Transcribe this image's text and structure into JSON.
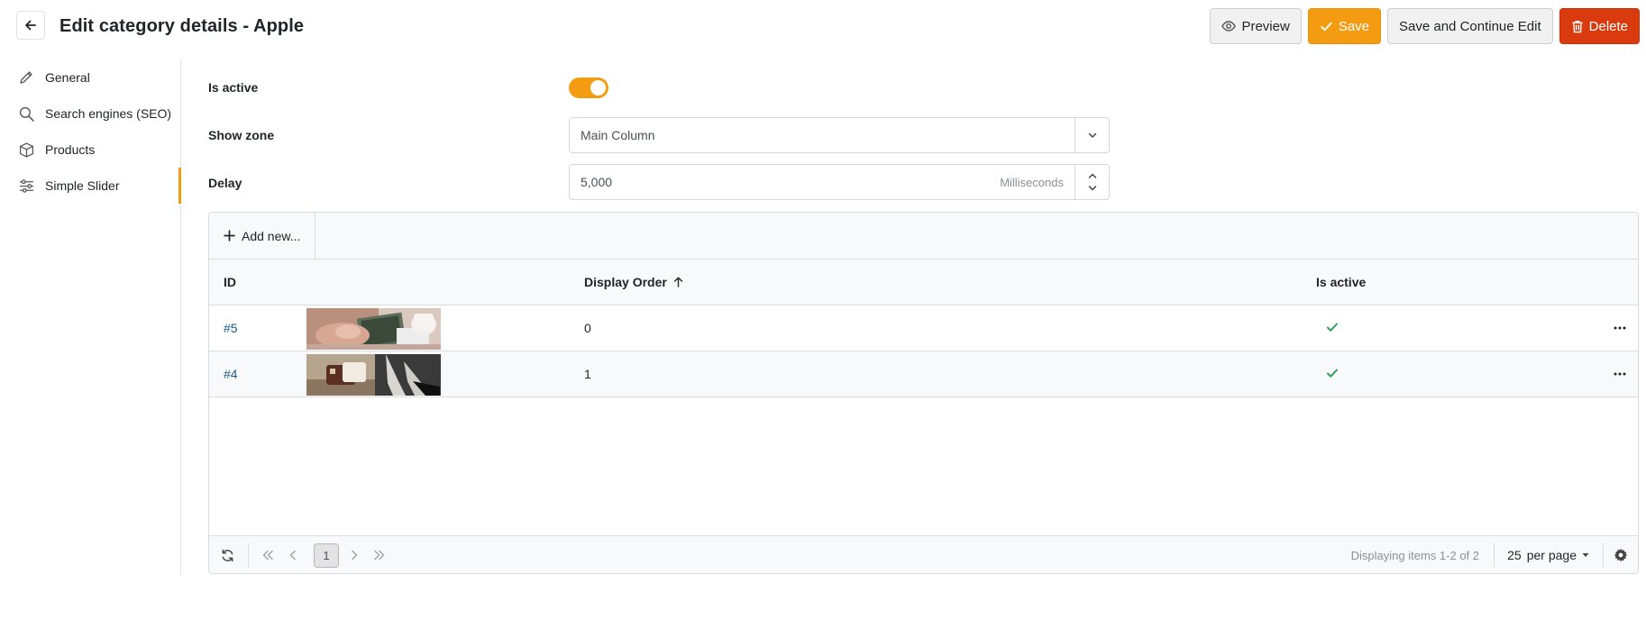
{
  "header": {
    "title": "Edit category details - Apple",
    "buttons": {
      "preview": "Preview",
      "save": "Save",
      "save_continue": "Save and Continue Edit",
      "delete": "Delete"
    }
  },
  "sidebar": {
    "items": [
      {
        "label": "General",
        "icon": "pencil-icon"
      },
      {
        "label": "Search engines (SEO)",
        "icon": "search-icon"
      },
      {
        "label": "Products",
        "icon": "box-icon"
      },
      {
        "label": "Simple Slider",
        "icon": "sliders-icon",
        "active": true
      }
    ]
  },
  "form": {
    "is_active_label": "Is active",
    "is_active": true,
    "show_zone_label": "Show zone",
    "show_zone_value": "Main Column",
    "delay_label": "Delay",
    "delay_value": "5,000",
    "delay_unit": "Milliseconds"
  },
  "grid": {
    "add_new": "Add new...",
    "columns": {
      "id": "ID",
      "display_order": "Display Order",
      "is_active": "Is active"
    },
    "rows": [
      {
        "id": "#5",
        "display_order": "0",
        "is_active": true
      },
      {
        "id": "#4",
        "display_order": "1",
        "is_active": true
      }
    ],
    "pager": {
      "current_page": "1",
      "info": "Displaying items 1-2 of 2",
      "per_page": "25",
      "per_page_label": "per page"
    }
  },
  "colors": {
    "accent": "#f39c12",
    "danger": "#d93a0e",
    "success": "#2e9e5b",
    "link": "#1a5a8a"
  }
}
